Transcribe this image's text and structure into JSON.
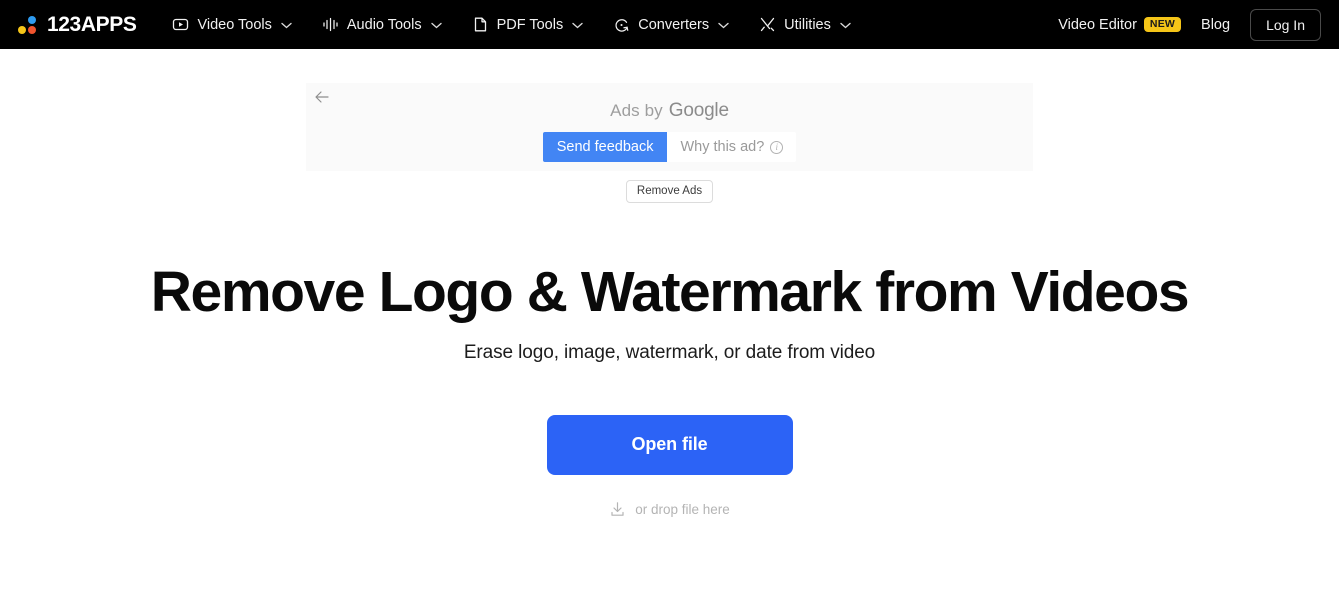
{
  "navbar": {
    "logo": {
      "text": "123APPS",
      "dot_blue": "#2E9BF0",
      "dot_yellow": "#F5C518",
      "dot_red": "#F0542E"
    },
    "items": [
      {
        "label": "Video Tools",
        "icon": "play-square-icon",
        "caret": "⌄"
      },
      {
        "label": "Audio Tools",
        "icon": "waveform-icon",
        "caret": "⌄"
      },
      {
        "label": "PDF Tools",
        "icon": "document-icon",
        "caret": "⌄"
      },
      {
        "label": "Converters",
        "icon": "refresh-circle-icon",
        "caret": "⌄"
      },
      {
        "label": "Utilities",
        "icon": "crossed-tools-icon",
        "caret": "⌄"
      }
    ],
    "video_editor_label": "Video Editor",
    "new_badge": "NEW",
    "blog_label": "Blog",
    "login_label": "Log In",
    "background": "#000000",
    "badge_color": "#F5C518"
  },
  "ad": {
    "back_icon": "back-arrow-icon",
    "ads_by_prefix": "Ads by",
    "ads_by_brand": "Google",
    "send_feedback_label": "Send feedback",
    "why_this_ad_label": "Why this ad?",
    "info_glyph": "i",
    "remove_ads_label": "Remove Ads",
    "feedback_button_color": "#4285F4",
    "panel_background": "#FAFAFA"
  },
  "hero": {
    "title": "Remove Logo & Watermark from Videos",
    "subtitle": "Erase logo, image, watermark, or date from video",
    "open_file_label": "Open file",
    "drop_hint": "or drop file here",
    "drop_icon": "download-icon",
    "accent_color": "#2C63F6"
  }
}
